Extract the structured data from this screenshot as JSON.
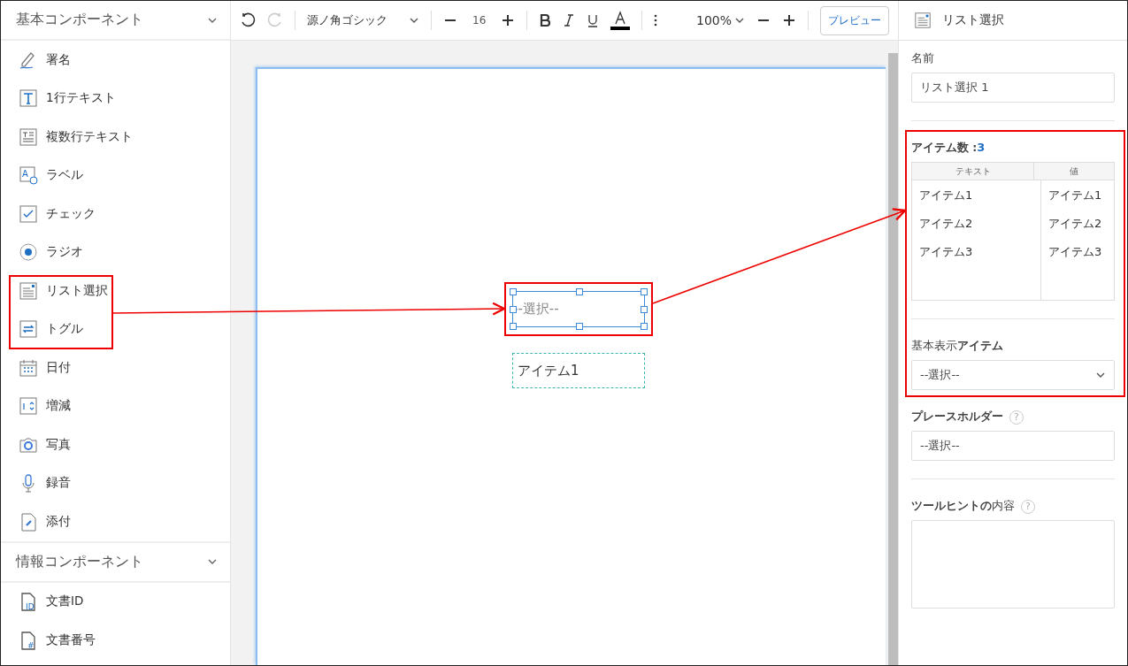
{
  "sidebar": {
    "sections": [
      {
        "title": "基本コンポーネント",
        "expanded": true,
        "items": [
          {
            "label": "署名",
            "kind": "signature"
          },
          {
            "label": "1行テキスト",
            "kind": "text"
          },
          {
            "label": "複数行テキスト",
            "kind": "textarea"
          },
          {
            "label": "ラベル",
            "kind": "label",
            "icon_text": "A"
          },
          {
            "label": "チェック",
            "kind": "check"
          },
          {
            "label": "ラジオ",
            "kind": "radio"
          },
          {
            "label": "リスト選択",
            "kind": "list"
          },
          {
            "label": "トグル",
            "kind": "toggle"
          },
          {
            "label": "日付",
            "kind": "date"
          },
          {
            "label": "増減",
            "kind": "stepper"
          },
          {
            "label": "写真",
            "kind": "photo"
          },
          {
            "label": "録音",
            "kind": "audio"
          },
          {
            "label": "添付",
            "kind": "attach"
          }
        ]
      },
      {
        "title": "情報コンポーネント",
        "expanded": true,
        "items": [
          {
            "label": "文書ID",
            "kind": "docid",
            "icon_text": "ID"
          },
          {
            "label": "文書番号",
            "kind": "docnum",
            "icon_text": "#"
          }
        ]
      }
    ]
  },
  "toolbar": {
    "redo_disabled": true,
    "font": "源ノ角ゴシック",
    "size": "16",
    "zoom": "100%",
    "preview": "プレビュー"
  },
  "canvas": {
    "list_field": {
      "placeholder": "--選択--",
      "selected": true
    },
    "text_field": {
      "value": "アイテム1"
    }
  },
  "properties": {
    "title": "リスト選択",
    "name_label": "名前",
    "name_value": "リスト選択 1",
    "items_label": "アイテム数 : ",
    "items_count": "3",
    "columns": [
      "テキスト",
      "値"
    ],
    "rows": [
      [
        "アイテム1",
        "アイテム1"
      ],
      [
        "アイテム2",
        "アイテム2"
      ],
      [
        "アイテム3",
        "アイテム3"
      ]
    ],
    "default_label": "基本表示**アイテム**",
    "default_value": "--選択--",
    "placeholder_label": "プレースホルダー",
    "placeholder_help": "?",
    "placeholder_value": "--選択--",
    "tooltip_label": "**ツールヒントの**内容",
    "tooltip_help": "?"
  }
}
